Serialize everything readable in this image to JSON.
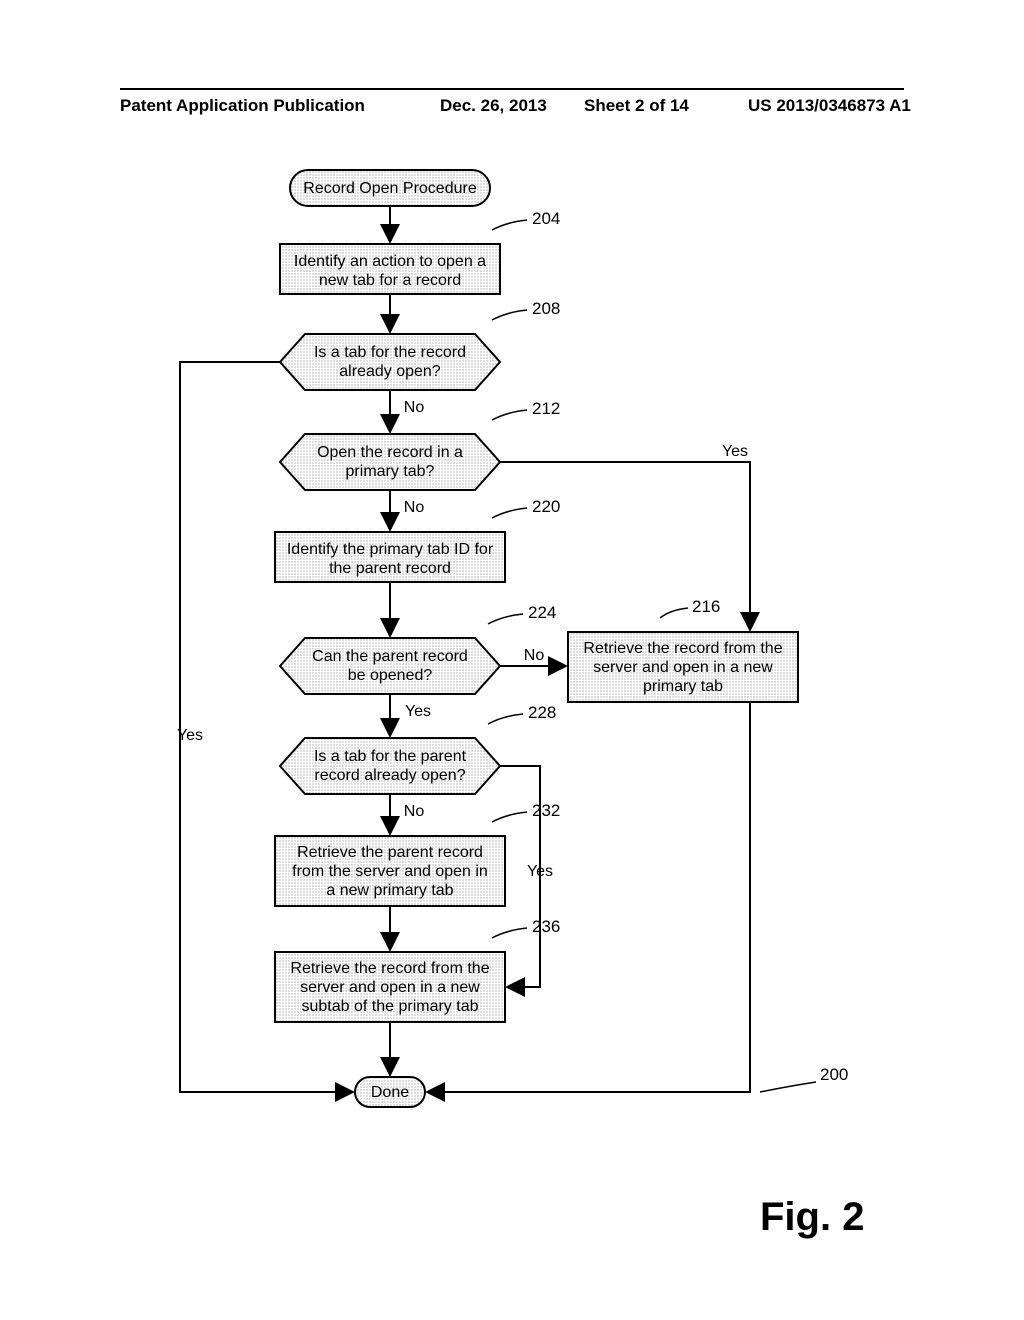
{
  "header": {
    "left": "Patent Application Publication",
    "date": "Dec. 26, 2013",
    "sheet": "Sheet 2 of 14",
    "pubnum": "US 2013/0346873 A1"
  },
  "figure_label": "Fig. 2",
  "nodes": {
    "start": "Record Open Procedure",
    "n204_l1": "Identify an action to open a",
    "n204_l2": "new tab for a record",
    "n208_l1": "Is a tab for the record",
    "n208_l2": "already open?",
    "n212_l1": "Open the record in a",
    "n212_l2": "primary tab?",
    "n220_l1": "Identify the primary tab ID for",
    "n220_l2": "the parent record",
    "n224_l1": "Can the parent record",
    "n224_l2": "be opened?",
    "n216_l1": "Retrieve the record from the",
    "n216_l2": "server and open in a new",
    "n216_l3": "primary tab",
    "n228_l1": "Is a tab for the parent",
    "n228_l2": "record already open?",
    "n232_l1": "Retrieve the parent record",
    "n232_l2": "from the server and open in",
    "n232_l3": "a new primary tab",
    "n236_l1": "Retrieve the record from the",
    "n236_l2": "server and open in a new",
    "n236_l3": "subtab of the primary tab",
    "done": "Done"
  },
  "edges": {
    "no": "No",
    "yes": "Yes"
  },
  "refs": {
    "r204": "204",
    "r208": "208",
    "r212": "212",
    "r220": "220",
    "r224": "224",
    "r216": "216",
    "r228": "228",
    "r232": "232",
    "r236": "236",
    "r200": "200"
  }
}
